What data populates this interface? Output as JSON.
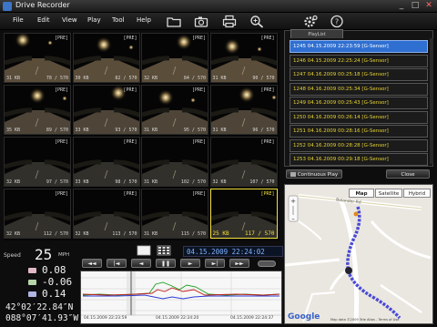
{
  "window": {
    "title": "Drive Recorder",
    "minimize": "_",
    "maximize": "□",
    "close": "✕"
  },
  "menu": [
    {
      "label": "File"
    },
    {
      "label": "Edit"
    },
    {
      "label": "View"
    },
    {
      "label": "Play"
    },
    {
      "label": "Tool"
    },
    {
      "label": "Help"
    }
  ],
  "toolbar_icons": [
    "folder-icon",
    "camera-icon",
    "print-icon",
    "zoom-icon",
    "gear-icon",
    "help-icon"
  ],
  "thumbnails": [
    {
      "pre": "[PRE]",
      "kb": "31 KB",
      "idx": "78 / 570"
    },
    {
      "pre": "[PRE]",
      "kb": "30 KB",
      "idx": "82 / 570"
    },
    {
      "pre": "[PRE]",
      "kb": "32 KB",
      "idx": "84 / 570"
    },
    {
      "pre": "[PRE]",
      "kb": "31 KB",
      "idx": "90 / 570"
    },
    {
      "pre": "[PRE]",
      "kb": "35 KB",
      "idx": "89 / 570"
    },
    {
      "pre": "[PRE]",
      "kb": "33 KB",
      "idx": "93 / 570"
    },
    {
      "pre": "[PRE]",
      "kb": "31 KB",
      "idx": "95 / 570"
    },
    {
      "pre": "[PRE]",
      "kb": "31 KB",
      "idx": "96 / 570"
    },
    {
      "pre": "[PRE]",
      "kb": "32 KB",
      "idx": "97 / 570"
    },
    {
      "pre": "[PRE]",
      "kb": "33 KB",
      "idx": "98 / 570"
    },
    {
      "pre": "[PRE]",
      "kb": "31 KB",
      "idx": "102 / 570"
    },
    {
      "pre": "[PRE]",
      "kb": "32 KB",
      "idx": "107 / 570"
    },
    {
      "pre": "[PRE]",
      "kb": "32 KB",
      "idx": "112 / 570"
    },
    {
      "pre": "[PRE]",
      "kb": "32 KB",
      "idx": "113 / 570"
    },
    {
      "pre": "[PRE]",
      "kb": "31 KB",
      "idx": "115 / 570"
    },
    {
      "pre": "[PRE]",
      "kb": "25 KB",
      "idx": "117 / 570"
    }
  ],
  "playlist": {
    "tab": "PlayList",
    "items": [
      {
        "label": "1245  04.15.2009  22:23:59  [G-Sensor]",
        "selected": true
      },
      {
        "label": "1246  04.15.2009  22:25:24  [G-Sensor]",
        "selected": false
      },
      {
        "label": "1247  04.16.2009  00:25:18  [G-Sensor]",
        "selected": false
      },
      {
        "label": "1248  04.16.2009  00:25:34  [G-Sensor]",
        "selected": false
      },
      {
        "label": "1249  04.16.2009  00:25:43  [G-Sensor]",
        "selected": false
      },
      {
        "label": "1250  04.16.2009  00:26:14  [G-Sensor]",
        "selected": false
      },
      {
        "label": "1251  04.16.2009  00:28:16  [G-Sensor]",
        "selected": false
      },
      {
        "label": "1252  04.16.2009  00:28:28  [G-Sensor]",
        "selected": false
      },
      {
        "label": "1253  04.16.2009  00:29:18  [G-Sensor]",
        "selected": false
      }
    ],
    "continuous_play": "Continuous Play",
    "close": "Close"
  },
  "map": {
    "tabs": [
      {
        "label": "Map",
        "selected": true
      },
      {
        "label": "Satellite",
        "selected": false
      },
      {
        "label": "Hybrid",
        "selected": false
      }
    ],
    "road_label": "Bolander Rd",
    "logo": "Google",
    "copyright": "Map data ©2009 Tele Atlas - Terms of Use"
  },
  "readouts": {
    "speed_label": "Speed",
    "speed_value": "25",
    "speed_unit": "MPH",
    "g_x": "0.08",
    "g_y": "-0.06",
    "g_z": "0.14",
    "latitude": "42°02′22.84″N",
    "longitude": "088°07′41.93″W"
  },
  "controls": {
    "datetime": "04.15.2009  22:24:02",
    "buttons": [
      "◄◄",
      "|◄",
      "◄",
      "❚❚",
      "►",
      "►|",
      "►►"
    ]
  },
  "graph": {
    "times": [
      "04.15.2009 22:23:59",
      "04.15.2009 22:24:20",
      "04.15.2009 22:24:37"
    ],
    "colors": {
      "x": "#c11c1c",
      "y": "#19a019",
      "z": "#2b3bd6"
    }
  }
}
